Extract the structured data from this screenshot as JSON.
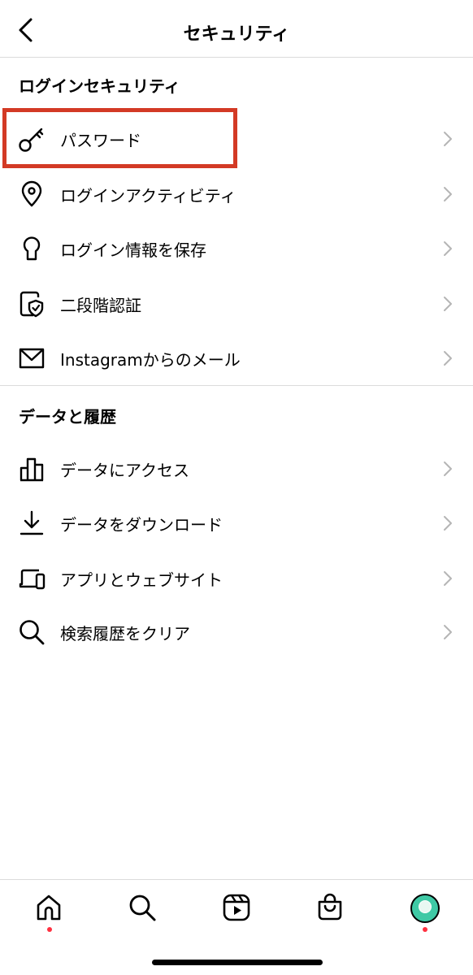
{
  "header": {
    "title": "セキュリティ"
  },
  "sections": [
    {
      "title": "ログインセキュリティ",
      "items": [
        {
          "label": "パスワード",
          "icon": "key-icon"
        },
        {
          "label": "ログインアクティビティ",
          "icon": "location-pin-icon"
        },
        {
          "label": "ログイン情報を保存",
          "icon": "keyhole-icon"
        },
        {
          "label": "二段階認証",
          "icon": "phone-shield-icon"
        },
        {
          "label": "Instagramからのメール",
          "icon": "mail-icon"
        }
      ]
    },
    {
      "title": "データと履歴",
      "items": [
        {
          "label": "データにアクセス",
          "icon": "bar-chart-icon"
        },
        {
          "label": "データをダウンロード",
          "icon": "download-icon"
        },
        {
          "label": "アプリとウェブサイト",
          "icon": "devices-icon"
        },
        {
          "label": "検索履歴をクリア",
          "icon": "search-icon"
        }
      ]
    }
  ],
  "highlight": {
    "target": "パスワード",
    "color": "#d33a25"
  },
  "tabbar": {
    "tabs": [
      "home-icon",
      "search-icon",
      "reels-icon",
      "shop-icon",
      "profile-avatar"
    ],
    "notification_dot_color": "#ff3040"
  }
}
